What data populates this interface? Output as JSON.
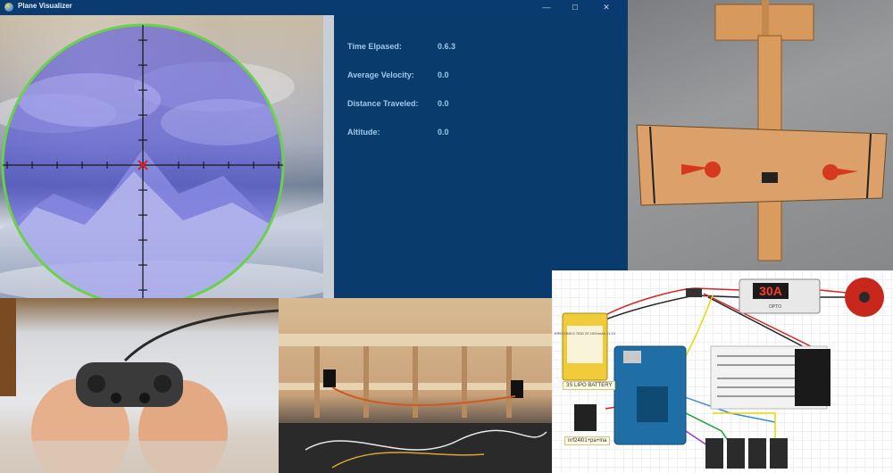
{
  "window": {
    "title": "Plane Visualizer",
    "controls": {
      "minimize": "—",
      "maximize": "☐",
      "close": "✕"
    }
  },
  "info": {
    "rows": [
      {
        "label": "Time Elpased:",
        "value": "0.6.3"
      },
      {
        "label": "Average Velocity:",
        "value": "0.0"
      },
      {
        "label": "Distance Traveled:",
        "value": "0.0"
      },
      {
        "label": "Altitude:",
        "value": "0.0"
      }
    ]
  },
  "circuit": {
    "esc_display": "30A",
    "esc_sub": "OPTO",
    "battery_label": "3S LIPO BATTERY",
    "radio_label": "nrf24l01+pa+lna",
    "battery_text": "ERECONKO 7530 2S 1000mAh 11.1V"
  },
  "colors": {
    "window_bg": "#0b3a6e",
    "info_text": "#9fc8ea",
    "scope_ring": "#6bd14a",
    "crosshair": "#1a1a1a",
    "center_mark": "#e02020"
  }
}
